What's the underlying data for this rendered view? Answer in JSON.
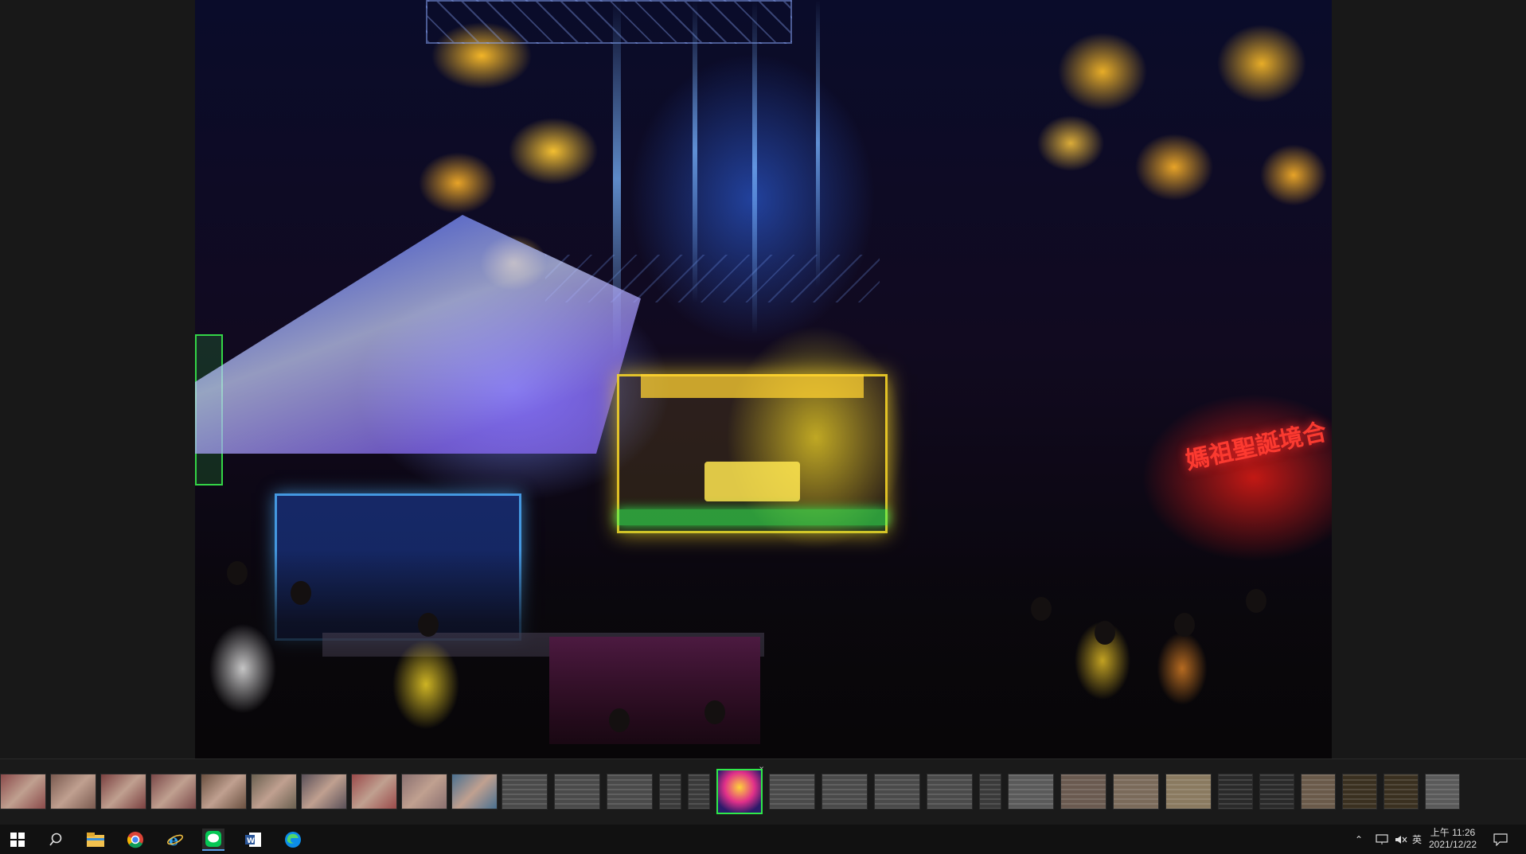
{
  "app": {
    "type": "Photos viewer"
  },
  "photo": {
    "neon_sign_text": "媽祖聖誕境合"
  },
  "filmstrip": {
    "thumbnails": [
      {
        "kind": "photo",
        "color": "#8a4a4a"
      },
      {
        "kind": "photo",
        "color": "#7a5a50"
      },
      {
        "kind": "photo",
        "color": "#7a4040"
      },
      {
        "kind": "photo",
        "color": "#7a4848"
      },
      {
        "kind": "photo",
        "color": "#6a5040"
      },
      {
        "kind": "photo",
        "color": "#6a6050"
      },
      {
        "kind": "photo",
        "color": "#5a5058"
      },
      {
        "kind": "photo",
        "color": "#9a4a4a"
      },
      {
        "kind": "photo",
        "color": "#8a7070"
      },
      {
        "kind": "photo",
        "color": "#4a7090"
      },
      {
        "kind": "doc",
        "color": "#4a4a4a"
      },
      {
        "kind": "doc",
        "color": "#4a4a4a"
      },
      {
        "kind": "doc",
        "color": "#4a4a4a"
      },
      {
        "kind": "doc",
        "color": "#3a3a3a"
      },
      {
        "kind": "doc",
        "color": "#3a3a3a"
      },
      {
        "kind": "photo-active",
        "color": "#3a2a6a"
      },
      {
        "kind": "doc",
        "color": "#4a4a4a"
      },
      {
        "kind": "doc",
        "color": "#4a4a4a"
      },
      {
        "kind": "doc",
        "color": "#4a4a4a"
      },
      {
        "kind": "doc",
        "color": "#4a4a4a"
      },
      {
        "kind": "doc",
        "color": "#3a3a3a"
      },
      {
        "kind": "doc",
        "color": "#5a5a5a"
      },
      {
        "kind": "doc",
        "color": "#6a5a50"
      },
      {
        "kind": "doc",
        "color": "#7a6a5a"
      },
      {
        "kind": "doc",
        "color": "#8a7a60"
      },
      {
        "kind": "doc",
        "color": "#2a2a2a"
      },
      {
        "kind": "doc",
        "color": "#2a2a2a"
      },
      {
        "kind": "doc",
        "color": "#6a5a4a"
      },
      {
        "kind": "doc",
        "color": "#3a3020"
      },
      {
        "kind": "doc",
        "color": "#3a3020"
      },
      {
        "kind": "doc",
        "color": "#5a5a5a"
      }
    ]
  },
  "taskbar": {
    "icons": [
      "windows-start-icon",
      "search-icon",
      "file-explorer-icon",
      "chrome-icon",
      "internet-explorer-icon",
      "line-icon",
      "word-icon",
      "edge-icon"
    ],
    "tray": {
      "ime": "英",
      "time": "上午 11:26",
      "date": "2021/12/22"
    }
  }
}
